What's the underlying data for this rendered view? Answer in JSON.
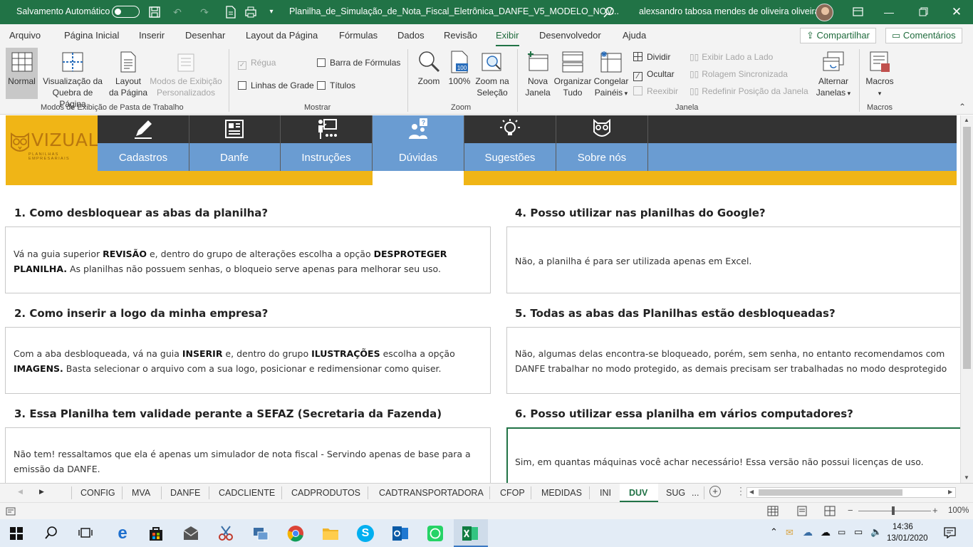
{
  "titlebar": {
    "autosave_label": "Salvamento Automático",
    "filename": "Planilha_de_Simulação_de_Nota_Fiscal_Eletrônica_DANFE_V5_MODELO_NOV...",
    "user": "alexsandro tabosa mendes de oliveira oliveira"
  },
  "ribbon_tabs": [
    "Arquivo",
    "Página Inicial",
    "Inserir",
    "Desenhar",
    "Layout da Página",
    "Fórmulas",
    "Dados",
    "Revisão",
    "Exibir",
    "Desenvolvedor",
    "Ajuda"
  ],
  "share": {
    "share_label": "Compartilhar",
    "comments_label": "Comentários"
  },
  "ribbon": {
    "views": {
      "normal": "Normal",
      "pagebreak_1": "Visualização da",
      "pagebreak_2": "Quebra de Página",
      "pagelayout_1": "Layout",
      "pagelayout_2": "da Página",
      "custom_1": "Modos de Exibição",
      "custom_2": "Personalizados",
      "group": "Modos de Exibição de Pasta de Trabalho"
    },
    "show": {
      "ruler": "Régua",
      "formula_bar": "Barra de Fórmulas",
      "gridlines": "Linhas de Grade",
      "headings": "Títulos",
      "group": "Mostrar"
    },
    "zoom": {
      "zoom": "Zoom",
      "hundred": "100%",
      "zoom_sel_1": "Zoom na",
      "zoom_sel_2": "Seleção",
      "group": "Zoom"
    },
    "window": {
      "new_1": "Nova",
      "new_2": "Janela",
      "arrange_1": "Organizar",
      "arrange_2": "Tudo",
      "freeze_1": "Congelar",
      "freeze_2": "Painéis",
      "split": "Dividir",
      "hide": "Ocultar",
      "unhide": "Reexibir",
      "side_by_side": "Exibir Lado a Lado",
      "sync_scroll": "Rolagem Sincronizada",
      "reset_pos": "Redefinir Posição da Janela",
      "switch_1": "Alternar",
      "switch_2": "Janelas",
      "group": "Janela"
    },
    "macros": {
      "label": "Macros",
      "group": "Macros"
    }
  },
  "sheet": {
    "logo_text": "VIZUAL",
    "logo_sub": "PLANILHAS EMPRESARIAIS",
    "nav": [
      {
        "label": "Cadastros",
        "icon": "pencil-icon"
      },
      {
        "label": "Danfe",
        "icon": "newspaper-icon"
      },
      {
        "label": "Instruções",
        "icon": "teacher-icon"
      },
      {
        "label": "Dúvidas",
        "icon": "question-people-icon"
      },
      {
        "label": "Sugestões",
        "icon": "lightbulb-icon"
      },
      {
        "label": "Sobre nós",
        "icon": "owl-icon"
      }
    ],
    "faq": [
      {
        "q": "1. Como desbloquear as abas da planilha?",
        "a1_pre": "Vá na guia superior ",
        "a1_b1": "REVISÃO",
        "a1_mid": " e, dentro do grupo de alterações escolha a opção ",
        "a1_b2": "DESPROTEGER",
        "a2_b": "PLANILHA.",
        "a2_rest": " As planilhas não possuem senhas, o bloqueio serve apenas para melhorar seu uso."
      },
      {
        "q": "2. Como inserir a logo da minha empresa?",
        "a1_pre": "Com a aba desbloqueada, vá na guia ",
        "a1_b1": "INSERIR",
        "a1_mid": " e, dentro do grupo ",
        "a1_b2": "ILUSTRAÇÕES",
        "a1_post": " escolha a opção",
        "a2_b": "IMAGENS.",
        "a2_rest": " Basta selecionar o arquivo com a sua logo, posicionar e redimensionar como quiser."
      },
      {
        "q": "3. Essa Planilha tem validade perante a SEFAZ (Secretaria da Fazenda)",
        "a1": "Não tem! ressaltamos que ela é apenas um simulador de nota fiscal - Servindo apenas de base para a",
        "a2": "emissão da DANFE."
      },
      {
        "q": "4. Posso utilizar nas planilhas do Google?",
        "a1": "Não, a planilha é para ser utilizada apenas em Excel."
      },
      {
        "q": "5. Todas as abas das Planilhas estão desbloqueadas?",
        "a1": "Não, algumas delas encontra-se bloqueado, porém, sem senha, no entanto recomendamos com",
        "a2": "DANFE trabalhar no modo protegido, as demais precisam ser trabalhadas no modo desprotegido"
      },
      {
        "q": "6. Posso utilizar essa planilha em vários computadores?",
        "a1": "Sim, em quantas máquinas você achar necessário! Essa versão não possui licenças de uso."
      }
    ]
  },
  "sheet_tabs": [
    "CONFIG",
    "MVA",
    "DANFE",
    "CADCLIENTE",
    "CADPRODUTOS",
    "CADTRANSPORTADORA",
    "CFOP",
    "MEDIDAS",
    "INI",
    "DUV",
    "SUG",
    "..."
  ],
  "active_sheet": "DUV",
  "status": {
    "zoom": "100%"
  },
  "taskbar": {
    "time": "14:36",
    "date": "13/01/2020"
  },
  "colors": {
    "excel_green": "#217346",
    "nav_dark": "#333333",
    "nav_blue": "#6a9cd2",
    "gold": "#f0b516"
  }
}
